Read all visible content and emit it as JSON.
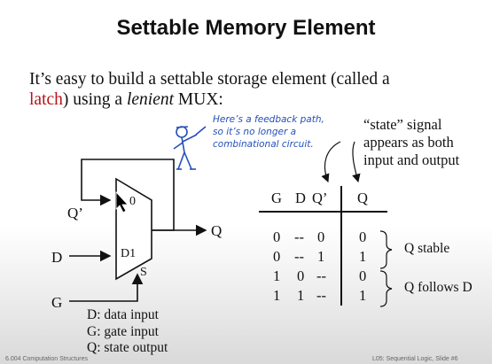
{
  "slide": {
    "title": "Settable Memory Element",
    "intro": {
      "part1": "It’s easy to build a settable storage element (called a",
      "latch": "latch",
      "part2": " using a ",
      "lenient": "lenient",
      "part3": " MUX:"
    },
    "note_line1": "Here’s a feedback path,",
    "note_line2": "so it’s no longer a",
    "note_line3": "combinational circuit.",
    "state_line1": "“state” signal",
    "state_line2": "appears as both",
    "state_line3": "input and output"
  },
  "circuit": {
    "qprime": "Q’",
    "d": "D",
    "g": "G",
    "q": "Q",
    "in0": "0",
    "in1": "D1",
    "sel": "S"
  },
  "table": {
    "headers": [
      "G",
      "D",
      "Q’",
      "Q"
    ],
    "rows": [
      [
        "0",
        "--",
        "0",
        "0"
      ],
      [
        "0",
        "--",
        "1",
        "1"
      ],
      [
        "1",
        "0",
        "--",
        "0"
      ],
      [
        "1",
        "1",
        "--",
        "1"
      ]
    ],
    "group1": "Q stable",
    "group2": "Q follows D"
  },
  "legend": [
    "D: data input",
    "G: gate input",
    "Q: state output"
  ],
  "footer": {
    "left": "6.004 Computation Structures",
    "right": "L05: Sequential Logic, Slide #6"
  }
}
